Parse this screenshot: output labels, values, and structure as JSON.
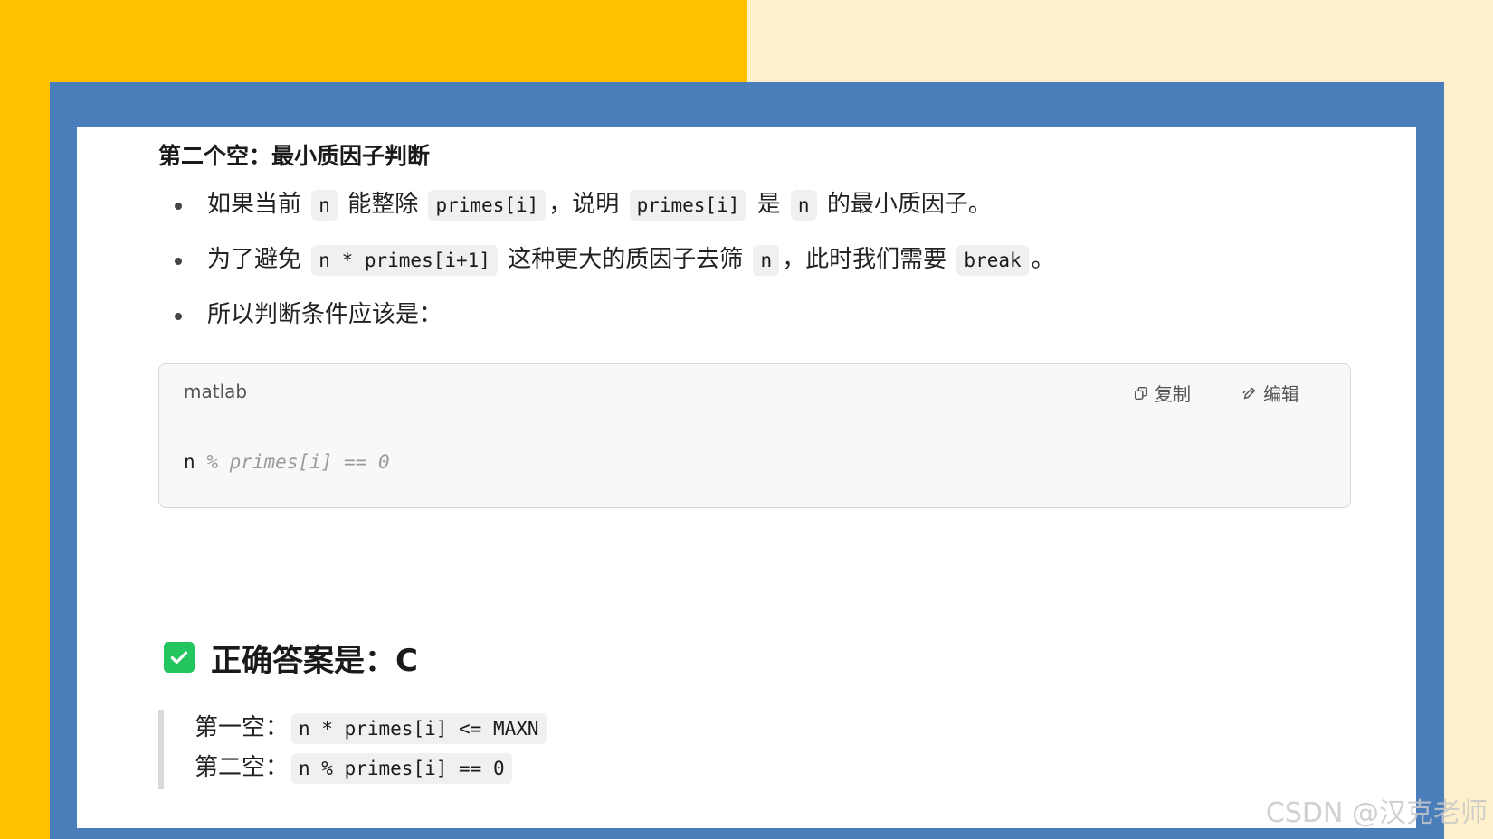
{
  "section_heading": "第二个空：最小质因子判断",
  "bullets": [
    {
      "t1": "如果当前",
      "c1": "n",
      "t2": "能整除",
      "c2": "primes[i]",
      "t3": "，说明",
      "c3": "primes[i]",
      "t4": "是",
      "c4": "n",
      "t5": "的最小质因子。"
    },
    {
      "t1": "为了避免",
      "c1": "n * primes[i+1]",
      "t2": "这种更大的质因子去筛",
      "c2": "n",
      "t3": "，此时我们需要",
      "c3": "break",
      "t4": "。"
    },
    {
      "t1": "所以判断条件应该是："
    }
  ],
  "code_block": {
    "language": "matlab",
    "copy_label": "复制",
    "edit_label": "编辑",
    "code_var": "n",
    "code_comment": "% primes[i] == 0",
    "icons": {
      "copy": "copy-icon",
      "edit": "edit-icon"
    }
  },
  "answer": {
    "heading": "正确答案是：C",
    "icon": "check-box-icon",
    "lines": [
      {
        "label": "第一空：",
        "code": "n * primes[i] <= MAXN"
      },
      {
        "label": "第二空：",
        "code": "n % primes[i] == 0"
      }
    ]
  },
  "watermark": "CSDN @汉克老师",
  "colors": {
    "left_background": "#ffc000",
    "right_background": "#fff0cc",
    "frame": "#4a7ebb",
    "check_green": "#22c55e"
  }
}
